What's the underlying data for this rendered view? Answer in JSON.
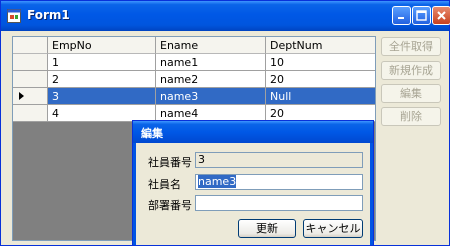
{
  "window": {
    "title": "Form1",
    "icon": "form-app-icon",
    "controls": {
      "minimize": "minimize-icon",
      "maximize": "maximize-icon",
      "close": "close-icon"
    }
  },
  "grid": {
    "columns": [
      "EmpNo",
      "Ename",
      "DeptNum"
    ],
    "rows": [
      {
        "empno": "1",
        "ename": "name1",
        "deptnum": "10"
      },
      {
        "empno": "2",
        "ename": "name2",
        "deptnum": "20"
      },
      {
        "empno": "3",
        "ename": "name3",
        "deptnum": "Null"
      },
      {
        "empno": "4",
        "ename": "name4",
        "deptnum": "20"
      }
    ],
    "selected_row": 2,
    "selection_color": "#316ac5"
  },
  "buttons": {
    "get_all": "全件取得",
    "new": "新規作成",
    "edit": "編集",
    "delete": "削除"
  },
  "dialog": {
    "title": "編集",
    "fields": {
      "emp_no_label": "社員番号",
      "emp_no_value": "3",
      "name_label": "社員名",
      "name_value": "name3",
      "dept_label": "部署番号",
      "dept_value": ""
    },
    "update_button": "更新",
    "cancel_button": "キャンセル"
  }
}
